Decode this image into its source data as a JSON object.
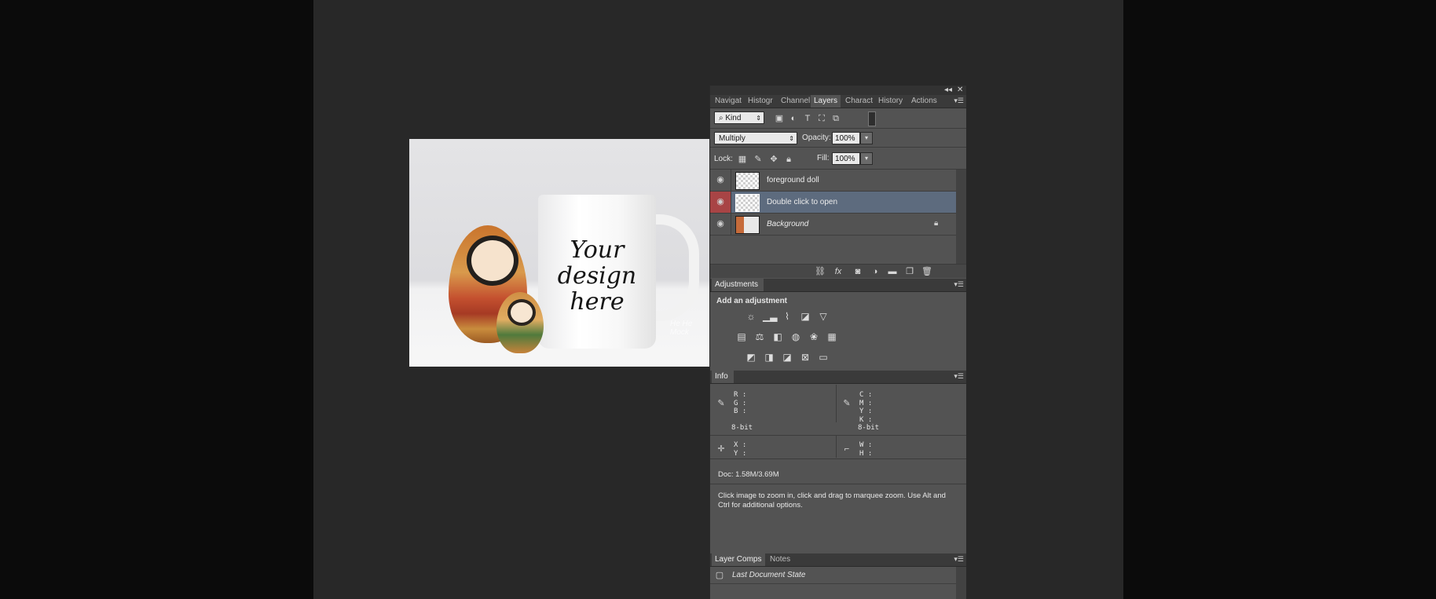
{
  "canvas": {
    "mug_text_lines": [
      "Your",
      "design",
      "here"
    ],
    "watermark": "He He Mock"
  },
  "panel_top": {
    "collapse_icon": "◂◂",
    "close_icon": "✕"
  },
  "tabs": [
    {
      "label": "Navigat",
      "active": false
    },
    {
      "label": "Histogr",
      "active": false
    },
    {
      "label": "Channel",
      "active": false
    },
    {
      "label": "Layers",
      "active": true
    },
    {
      "label": "Charact",
      "active": false
    },
    {
      "label": "History",
      "active": false
    },
    {
      "label": "Actions",
      "active": false
    }
  ],
  "layers_panel": {
    "filter_kind": "Kind",
    "blend_mode": "Multiply",
    "opacity_label": "Opacity:",
    "opacity_value": "100%",
    "lock_label": "Lock:",
    "fill_label": "Fill:",
    "fill_value": "100%",
    "layers": [
      {
        "name": "foreground doll",
        "selected": false,
        "locked": false
      },
      {
        "name": "Double click to open",
        "selected": true,
        "locked": false
      },
      {
        "name": "Background",
        "selected": false,
        "locked": true
      }
    ]
  },
  "adjustments": {
    "tab_label": "Adjustments",
    "heading": "Add an adjustment"
  },
  "info": {
    "tab_label": "Info",
    "rgb_block": "R :\nG :\nB :",
    "cmyk_block": "C :\nM :\nY :\nK :",
    "bit_depth_left": "8-bit",
    "bit_depth_right": "8-bit",
    "xy_block": "X :\nY :",
    "wh_block": "W :\nH :",
    "doc_size": "Doc: 1.58M/3.69M",
    "hint": "Click image to zoom in, click and  drag to marquee zoom.  Use Alt and Ctrl for additional options."
  },
  "bottom_tabs": [
    {
      "label": "Layer Comps",
      "active": true
    },
    {
      "label": "Notes",
      "active": false
    }
  ],
  "layer_comps": {
    "item": "Last Document State"
  }
}
